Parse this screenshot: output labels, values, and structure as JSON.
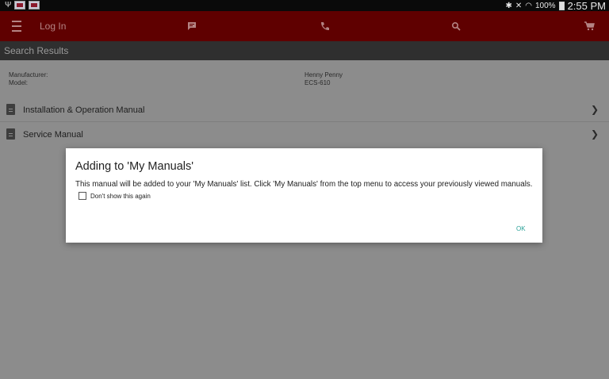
{
  "status_bar": {
    "left_icons": [
      "usb-icon",
      "flag-icon",
      "flag-icon"
    ],
    "battery": "100%",
    "time": "2:55 PM"
  },
  "toolbar": {
    "login_label": "Log In",
    "icons": [
      "menu-icon",
      "chat-icon",
      "phone-icon",
      "search-icon",
      "cart-icon"
    ]
  },
  "subheader": {
    "title": "Search Results"
  },
  "details": {
    "manufacturer_label": "Manufacturer:",
    "model_label": "Model:",
    "manufacturer_value": "Henny Penny",
    "model_value": "ECS-610"
  },
  "manuals": [
    {
      "label": "Installation & Operation Manual"
    },
    {
      "label": "Service Manual"
    }
  ],
  "dialog": {
    "title": "Adding to 'My Manuals'",
    "message": "This manual will be added to your 'My Manuals' list. Click 'My Manuals' from the top menu to access your previously viewed manuals.",
    "checkbox_label": "Don't show this again",
    "checkbox_checked": false,
    "ok_label": "OK"
  },
  "colors": {
    "toolbar": "#5f0000",
    "subheader": "#2f2f2f",
    "overlay": "#8c8c8c",
    "accent": "#2aa198"
  }
}
